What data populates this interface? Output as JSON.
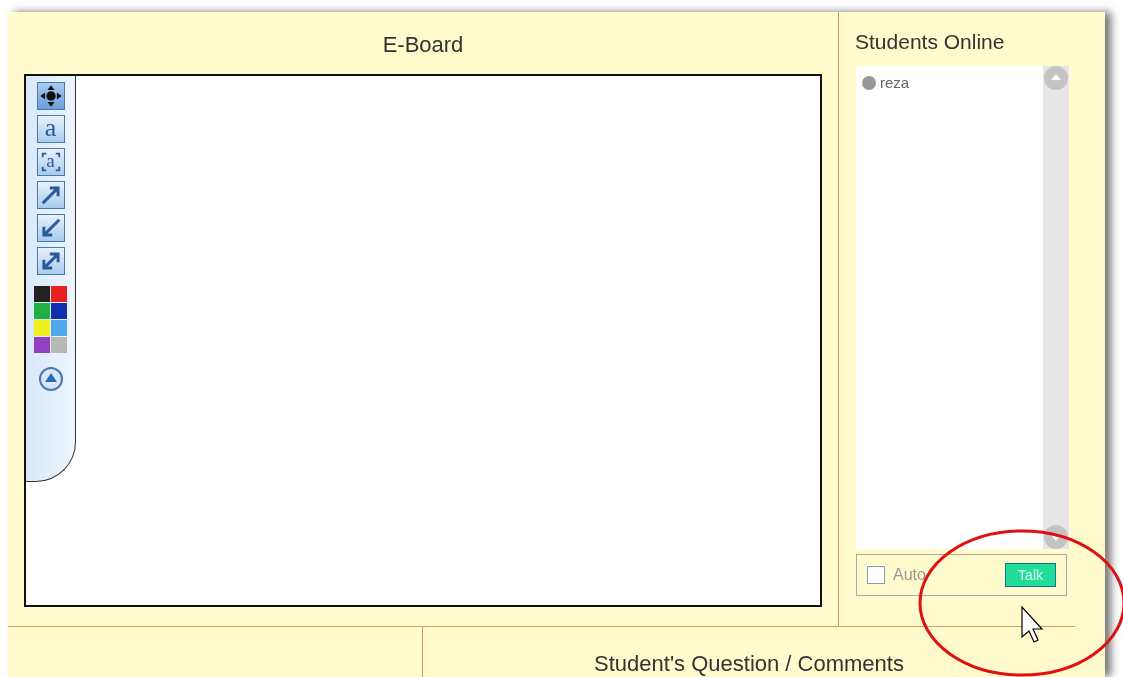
{
  "eboard": {
    "title": "E-Board",
    "tools": [
      {
        "kind": "move",
        "selected": true
      },
      {
        "kind": "text",
        "glyph": "a",
        "selected": false
      },
      {
        "kind": "text-box",
        "glyph": "a",
        "selected": false
      },
      {
        "kind": "arrow-up-right",
        "selected": false
      },
      {
        "kind": "arrow-down-left",
        "selected": false
      },
      {
        "kind": "arrow-both",
        "selected": false
      }
    ],
    "palette": [
      {
        "color": "#222222"
      },
      {
        "color": "#e82020"
      },
      {
        "color": "#20b040"
      },
      {
        "color": "#1030b0"
      },
      {
        "color": "#f0f020"
      },
      {
        "color": "#50a8e8"
      },
      {
        "color": "#9040c0"
      },
      {
        "color": "#b8b8b8"
      }
    ]
  },
  "students_online": {
    "title": "Students Online",
    "students": [
      {
        "name": "reza"
      }
    ],
    "auto": {
      "label": "Auto",
      "checked": false
    },
    "talk_button": "Talk"
  },
  "comments": {
    "title": "Student's Question / Comments"
  }
}
